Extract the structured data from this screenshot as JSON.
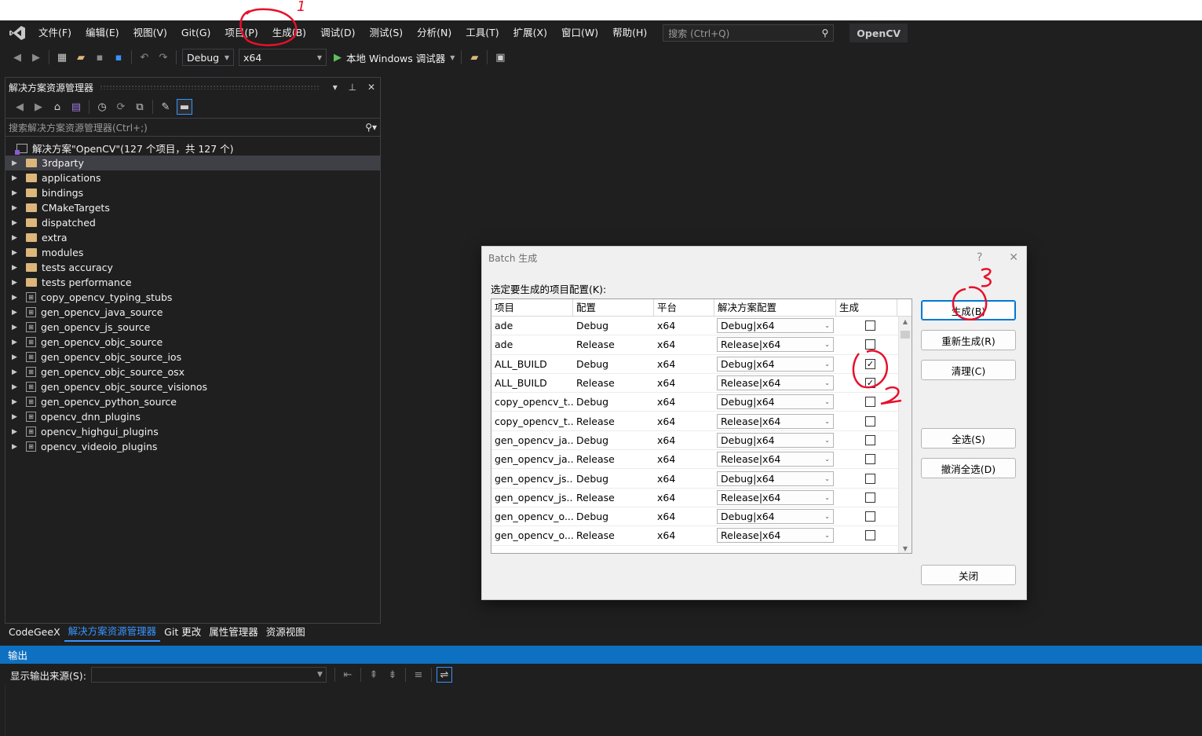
{
  "menubar": {
    "items": [
      "文件(F)",
      "编辑(E)",
      "视图(V)",
      "Git(G)",
      "项目(P)",
      "生成(B)",
      "调试(D)",
      "测试(S)",
      "分析(N)",
      "工具(T)",
      "扩展(X)",
      "窗口(W)",
      "帮助(H)"
    ],
    "search_placeholder": "搜索 (Ctrl+Q)",
    "project_name": "OpenCV"
  },
  "toolbar": {
    "config": "Debug",
    "platform": "x64",
    "run_label": "本地 Windows 调试器"
  },
  "solution_explorer": {
    "title": "解决方案资源管理器",
    "search_placeholder": "搜索解决方案资源管理器(Ctrl+;)",
    "solution_label": "解决方案\"OpenCV\"(127 个项目，共 127 个)",
    "folders": [
      "3rdparty",
      "applications",
      "bindings",
      "CMakeTargets",
      "dispatched",
      "extra",
      "modules",
      "tests accuracy",
      "tests performance"
    ],
    "projects": [
      "copy_opencv_typing_stubs",
      "gen_opencv_java_source",
      "gen_opencv_js_source",
      "gen_opencv_objc_source",
      "gen_opencv_objc_source_ios",
      "gen_opencv_objc_source_osx",
      "gen_opencv_objc_source_visionos",
      "gen_opencv_python_source",
      "opencv_dnn_plugins",
      "opencv_highgui_plugins",
      "opencv_videoio_plugins"
    ]
  },
  "bottom_tabs": [
    "CodeGeeX",
    "解决方案资源管理器",
    "Git 更改",
    "属性管理器",
    "资源视图"
  ],
  "output": {
    "title": "输出",
    "source_label": "显示输出来源(S):"
  },
  "batch_dialog": {
    "title": "Batch 生成",
    "help": "?",
    "close_x": "✕",
    "label": "选定要生成的项目配置(K):",
    "columns": [
      "项目",
      "配置",
      "平台",
      "解决方案配置",
      "生成"
    ],
    "rows": [
      {
        "project": "ade",
        "config": "Debug",
        "platform": "x64",
        "solution": "Debug|x64",
        "build": false
      },
      {
        "project": "ade",
        "config": "Release",
        "platform": "x64",
        "solution": "Release|x64",
        "build": false
      },
      {
        "project": "ALL_BUILD",
        "config": "Debug",
        "platform": "x64",
        "solution": "Debug|x64",
        "build": true
      },
      {
        "project": "ALL_BUILD",
        "config": "Release",
        "platform": "x64",
        "solution": "Release|x64",
        "build": true
      },
      {
        "project": "copy_opencv_t...",
        "config": "Debug",
        "platform": "x64",
        "solution": "Debug|x64",
        "build": false
      },
      {
        "project": "copy_opencv_t...",
        "config": "Release",
        "platform": "x64",
        "solution": "Release|x64",
        "build": false
      },
      {
        "project": "gen_opencv_ja...",
        "config": "Debug",
        "platform": "x64",
        "solution": "Debug|x64",
        "build": false
      },
      {
        "project": "gen_opencv_ja...",
        "config": "Release",
        "platform": "x64",
        "solution": "Release|x64",
        "build": false
      },
      {
        "project": "gen_opencv_js...",
        "config": "Debug",
        "platform": "x64",
        "solution": "Debug|x64",
        "build": false
      },
      {
        "project": "gen_opencv_js...",
        "config": "Release",
        "platform": "x64",
        "solution": "Release|x64",
        "build": false
      },
      {
        "project": "gen_opencv_o...",
        "config": "Debug",
        "platform": "x64",
        "solution": "Debug|x64",
        "build": false
      },
      {
        "project": "gen_opencv_o...",
        "config": "Release",
        "platform": "x64",
        "solution": "Release|x64",
        "build": false
      }
    ],
    "buttons": {
      "build": "生成(B)",
      "rebuild": "重新生成(R)",
      "clean": "清理(C)",
      "select_all": "全选(S)",
      "deselect_all": "撤消全选(D)",
      "close": "关闭"
    }
  },
  "annotations": {
    "mark1": "1",
    "mark2": "2",
    "mark3": "3"
  },
  "colors": {
    "accent": "#0e70c0",
    "annotation": "#e8102a"
  }
}
